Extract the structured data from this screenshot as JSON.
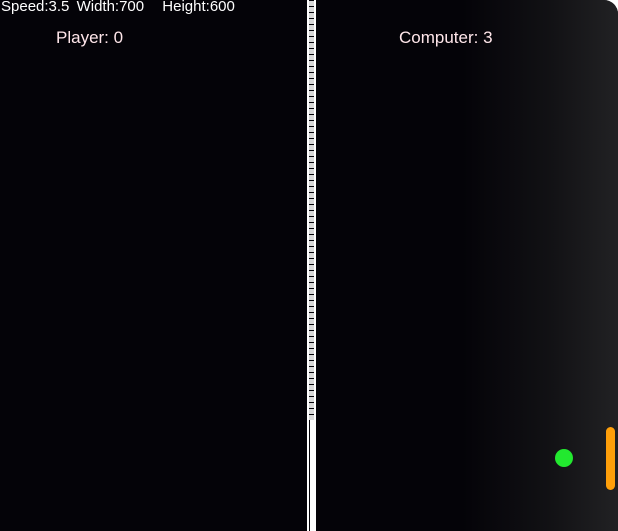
{
  "hud": {
    "speed_label": "Speed:3.5",
    "width_label": "Width:700",
    "height_label": "Height:600"
  },
  "scores": {
    "player_label": "Player: 0",
    "computer_label": "Computer: 3"
  },
  "colors": {
    "background": "#040308",
    "divider": "#ffffff",
    "score_text": "#ffe6ea",
    "ball": "#22e82f",
    "paddle": "#ff9f0a"
  }
}
